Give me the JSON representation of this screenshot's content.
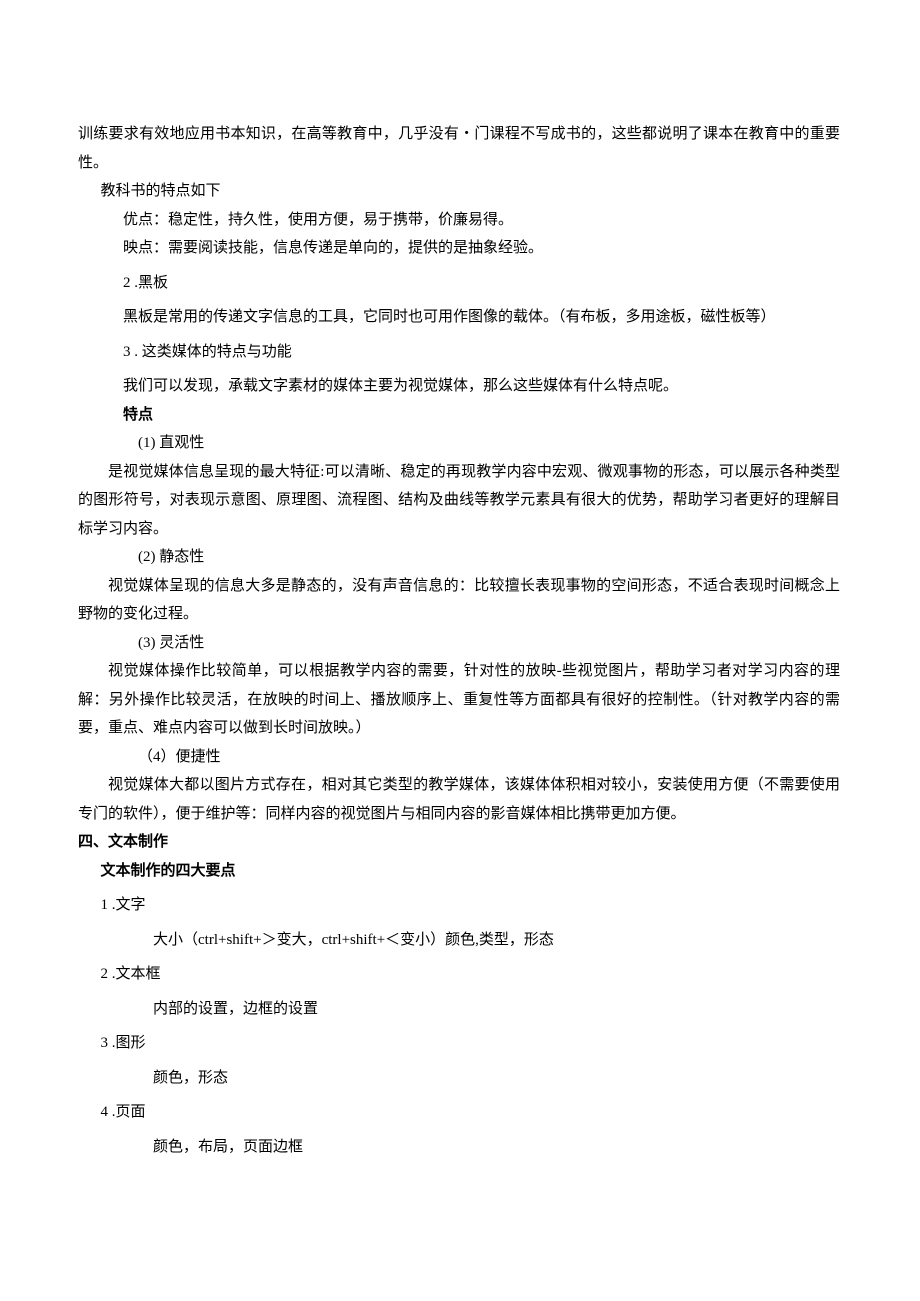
{
  "p1": "训练要求有效地应用书本知识，在高等教育中，几乎没有・门课程不写成书的，这些都说明了课本在教育中的重要性。",
  "p2": "教科书的特点如下",
  "p3": "优点：稳定性，持久性，使用方便，易于携带，价廉易得。",
  "p4": "映点：需要阅读技能，信息传递是单向的，提供的是抽象经验。",
  "n2": "2",
  "t2": ".黑板",
  "p5": "黑板是常用的传递文字信息的工具，它同时也可用作图像的载体。（有布板，多用途板，磁性板等）",
  "n3": "3",
  "t3": ". 这类媒体的特点与功能",
  "p6": "我们可以发现，承载文字素材的媒体主要为视觉媒体，那么这些媒体有什么特点呢。",
  "h1": "特点",
  "c1": "(1) 直观性",
  "p7": "是视觉媒体信息呈现的最大特征:可以清晰、稳定的再现教学内容中宏观、微观事物的形态，可以展示各种类型的图形符号，对表现示意图、原理图、流程图、结构及曲线等教学元素具有很大的优势，帮助学习者更好的理解目标学习内容。",
  "c2": "(2) 静态性",
  "p8": "视觉媒体呈现的信息大多是静态的，没有声音信息的：比较擅长表现事物的空间形态，不适合表现时间概念上野物的变化过程。",
  "c3": "(3) 灵活性",
  "p9": "视觉媒体操作比较简单，可以根据教学内容的需要，针对性的放映-些视觉图片，帮助学习者对学习内容的理解：另外操作比较灵活，在放映的时间上、播放顺序上、重复性等方面都具有很好的控制性。（针对教学内容的需要，重点、难点内容可以做到长时间放映。）",
  "c4": "（4）便捷性",
  "p10": "视觉媒体大都以图片方式存在，相对其它类型的教学媒体，该媒体体积相对较小，安装使用方便（不需要使用专门的软件），便于维护等：同样内容的视觉图片与相同内容的影音媒体相比携带更加方便。",
  "h2": "四、文本制作",
  "h3": "文本制作的四大要点",
  "ln1": "1",
  "lt1": ".文字",
  "ld1": "大小（ctrl+shift+＞变大，ctrl+shift+＜变小）颜色,类型，形态",
  "ln2": "2",
  "lt2": ".文本框",
  "ld2": "内部的设置，边框的设置",
  "ln3": "3",
  "lt3": ".图形",
  "ld3": "颜色，形态",
  "ln4": "4",
  "lt4": ".页面",
  "ld4": "颜色，布局，页面边框"
}
